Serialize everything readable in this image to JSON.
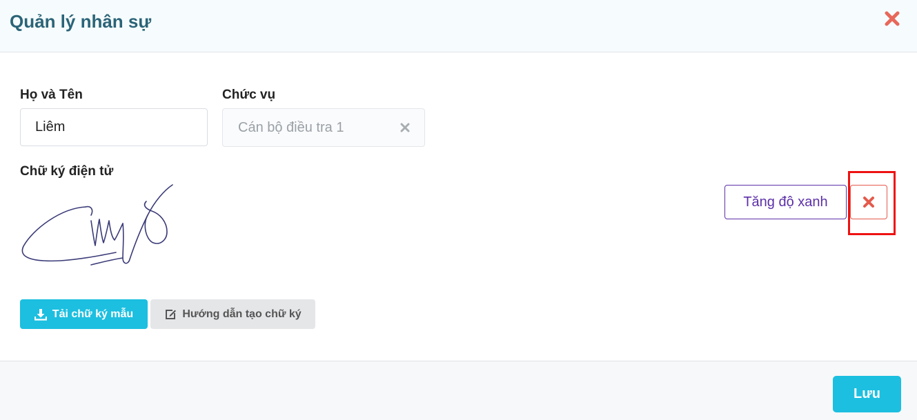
{
  "modal": {
    "title": "Quản lý nhân sự",
    "close_icon": "close-icon"
  },
  "form": {
    "name": {
      "label": "Họ và Tên",
      "value": "Liêm"
    },
    "position": {
      "label": "Chức vụ",
      "value": "Cán bộ điều tra 1"
    },
    "signature": {
      "label": "Chữ ký điện tử"
    }
  },
  "signature_actions": {
    "increase_blue_label": "Tăng độ xanh",
    "remove_icon": "close-icon"
  },
  "buttons": {
    "download_sample": "Tải chữ ký mẫu",
    "guide": "Hướng dẫn tạo chữ ký",
    "save": "Lưu"
  },
  "colors": {
    "accent": "#1cbfe0",
    "title": "#2b6478",
    "danger": "#e45a4c",
    "outline_purple": "#5b2fa8",
    "highlight": "#ee1111"
  }
}
